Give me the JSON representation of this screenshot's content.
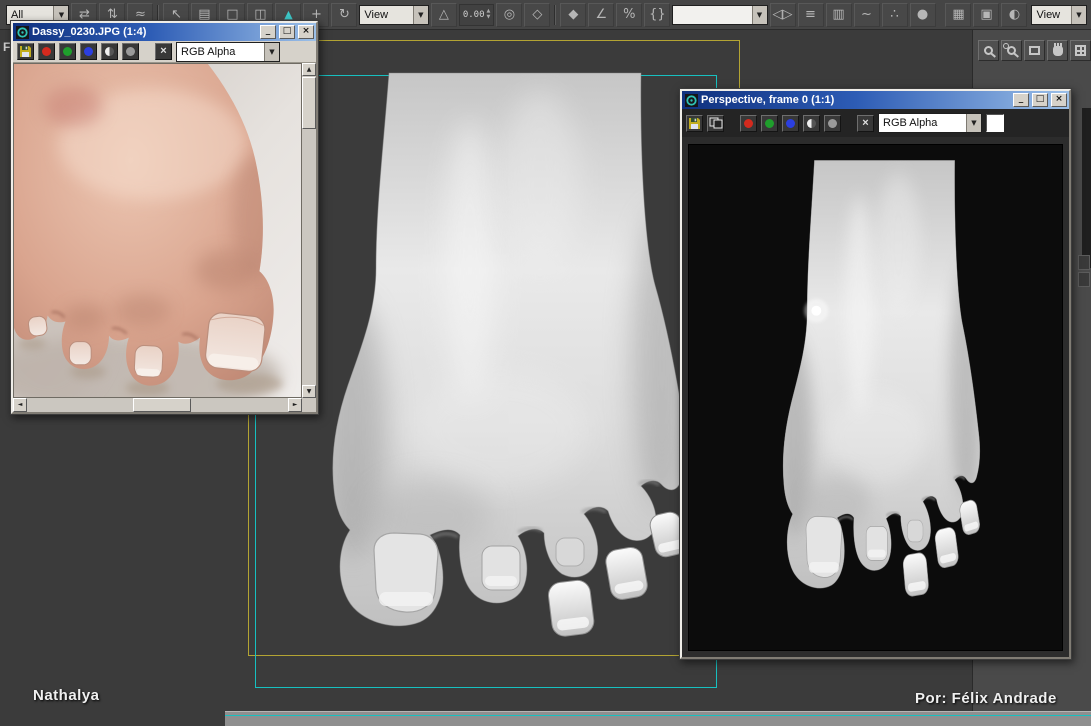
{
  "top_toolbar": {
    "selection_filter": {
      "value": "All"
    },
    "reference_coordsys": {
      "value": "View"
    },
    "view_combo_right": {
      "value": "View"
    },
    "named_selection_combo": {
      "value": ""
    },
    "offset_spinner": {
      "value": "0.00"
    },
    "up_arrow_icon": "▲",
    "spinner_up": "▲",
    "spinner_down": "▼",
    "buttons": [
      {
        "name": "select-and-link",
        "icon": "⇄"
      },
      {
        "name": "unlink-selection",
        "icon": "⇅"
      },
      {
        "name": "bind-to-spacewarp",
        "icon": "≈"
      },
      {
        "name": "select-object",
        "icon": "↖"
      },
      {
        "name": "select-by-name",
        "icon": "▤"
      },
      {
        "name": "rectangular-selection-region",
        "icon": "□"
      },
      {
        "name": "window-crossing-toggle",
        "icon": "◫"
      },
      {
        "name": "select-and-move",
        "icon": "+"
      },
      {
        "name": "select-and-rotate",
        "icon": "↻"
      },
      {
        "name": "select-and-scale",
        "icon": "△"
      },
      {
        "name": "use-pivot-point-center",
        "icon": "◎"
      },
      {
        "name": "select-and-manipulate",
        "icon": "◇"
      },
      {
        "name": "snap-toggle",
        "icon": "◆"
      },
      {
        "name": "angle-snap-toggle",
        "icon": "∠"
      },
      {
        "name": "percent-snap-toggle",
        "icon": "%"
      },
      {
        "name": "keyboard-shortcut-override",
        "icon": "{}"
      },
      {
        "name": "mirror",
        "icon": "◁▷"
      },
      {
        "name": "align",
        "icon": "≡"
      },
      {
        "name": "layer-manager",
        "icon": "▥"
      },
      {
        "name": "curve-editor",
        "icon": "~"
      },
      {
        "name": "schematic-view",
        "icon": "∴"
      },
      {
        "name": "material-editor",
        "icon": "●"
      },
      {
        "name": "render-setup",
        "icon": "▦"
      },
      {
        "name": "rendered-frame-window",
        "icon": "▣"
      },
      {
        "name": "quick-render",
        "icon": "◐"
      }
    ]
  },
  "right_panel": {
    "nav_buttons": [
      {
        "name": "zoom"
      },
      {
        "name": "zoom-all"
      },
      {
        "name": "zoom-extents"
      },
      {
        "name": "pan"
      },
      {
        "name": "min-max-toggle"
      }
    ]
  },
  "dassy_window": {
    "title": "Dassy_0230.JPG (1:4)",
    "channel_select": {
      "value": "RGB Alpha"
    },
    "controls": {
      "minimize": "_",
      "maximize": "□",
      "close": "×"
    }
  },
  "perspective_window": {
    "title": "Perspective, frame 0 (1:1)",
    "channel_select": {
      "value": "RGB Alpha"
    },
    "controls": {
      "minimize": "_",
      "maximize": "□",
      "close": "×"
    }
  },
  "viewport": {
    "label": "F",
    "credit_left": "Nathalya",
    "credit_right": "Por: Félix Andrade",
    "safe_frame_colors": {
      "live_area": "#b3a433",
      "action_safe": "#17c0c0"
    }
  },
  "icons": {
    "dropdown_arrow": "▼",
    "clear_x": "×",
    "scroll_up": "▲",
    "scroll_down": "▼",
    "scroll_left": "◄",
    "scroll_right": "►"
  },
  "colors": {
    "channel_red": "#d42a1e",
    "channel_green": "#1f9e2c",
    "channel_blue": "#2b3fe0",
    "titlebar_left": "#10317e",
    "titlebar_right": "#9cc0e8",
    "toolbar_bg": "#454545",
    "viewport_bg": "#3b3b3b"
  }
}
